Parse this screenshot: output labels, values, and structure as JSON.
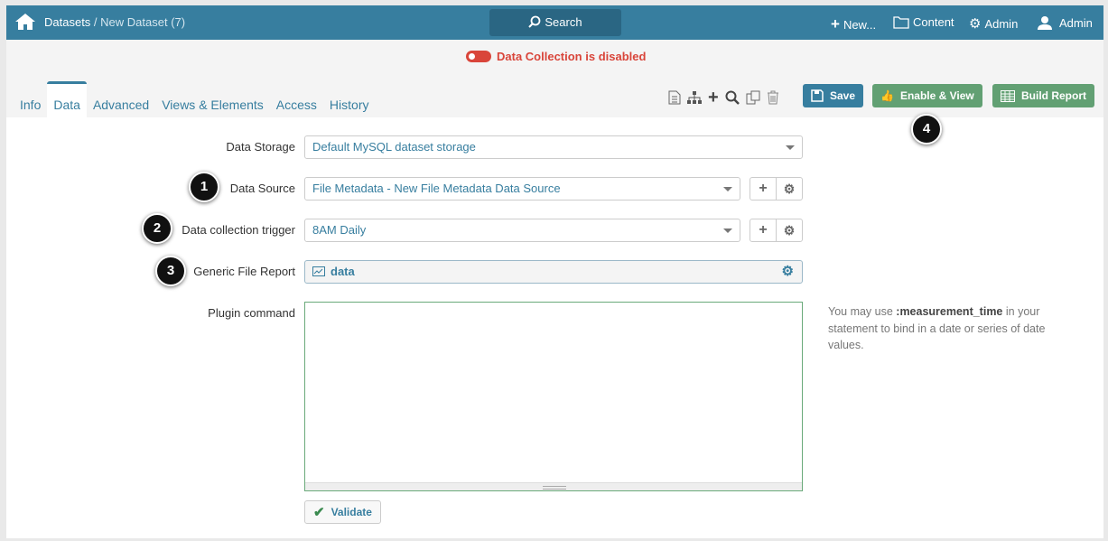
{
  "header": {
    "breadcrumb_root": "Datasets",
    "breadcrumb_sep": " / ",
    "breadcrumb_current": "New Dataset (7)",
    "search": "Search",
    "new": "New...",
    "content": "Content",
    "admin_settings": "Admin",
    "user": "Admin"
  },
  "status": {
    "text": "Data Collection is disabled",
    "enabled": false
  },
  "tabs": [
    "Info",
    "Data",
    "Advanced",
    "Views & Elements",
    "Access",
    "History"
  ],
  "active_tab": "Data",
  "buttons": {
    "save": "Save",
    "enable_view": "Enable & View",
    "build_report": "Build Report",
    "validate": "Validate"
  },
  "form": {
    "data_storage": {
      "label": "Data Storage",
      "value": "Default MySQL dataset storage"
    },
    "data_source": {
      "label": "Data Source",
      "value": "File Metadata - New File Metadata Data Source"
    },
    "trigger": {
      "label": "Data collection trigger",
      "value": "8AM Daily"
    },
    "report": {
      "label": "Generic File Report",
      "value": "data"
    },
    "plugin": {
      "label": "Plugin command",
      "value": ""
    }
  },
  "hint": {
    "pre": "You may use ",
    "bold": ":measurement_time",
    "post": " in your statement to bind in a date or series of date values."
  },
  "callouts": [
    "1",
    "2",
    "3",
    "4"
  ],
  "colors": {
    "primary": "#377e9f",
    "success": "#62a073",
    "danger": "#d9453a"
  }
}
